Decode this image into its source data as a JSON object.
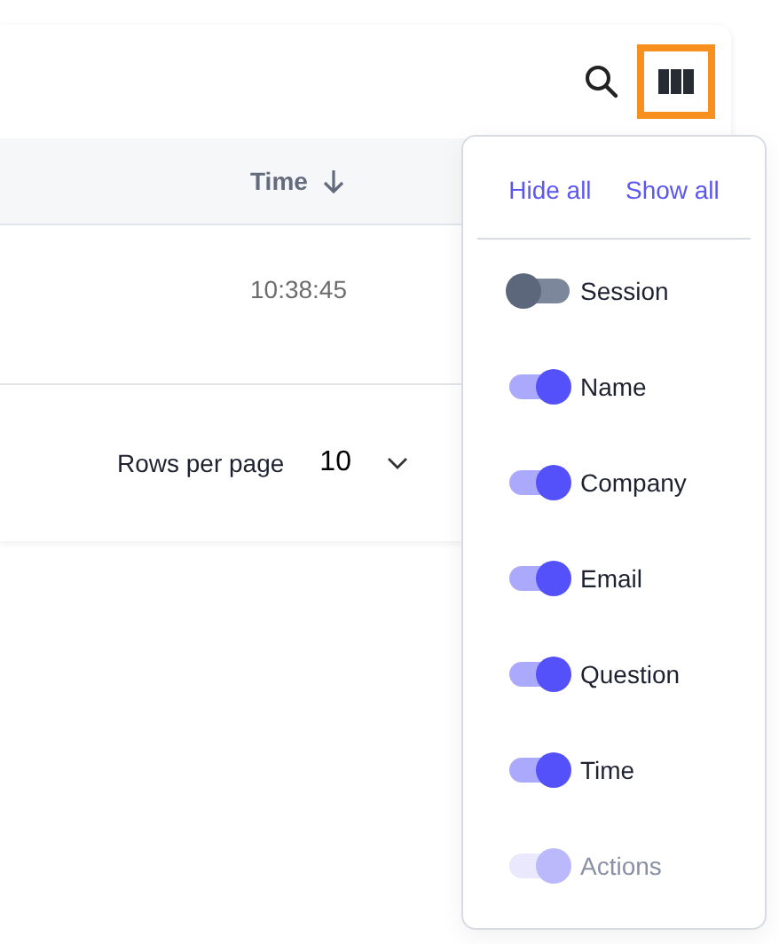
{
  "table": {
    "columns": [
      {
        "label": "Time",
        "sorted_descending": true
      }
    ],
    "rows": [
      {
        "time": "10:38:45"
      }
    ],
    "footer": {
      "rows_per_page_label": "Rows per page",
      "rows_per_page": "10"
    }
  },
  "column_menu": {
    "hide_all": "Hide all",
    "show_all": "Show all",
    "columns": [
      {
        "label": "Session",
        "checked": false,
        "disabled": false
      },
      {
        "label": "Name",
        "checked": true,
        "disabled": false
      },
      {
        "label": "Company",
        "checked": true,
        "disabled": false
      },
      {
        "label": "Email",
        "checked": true,
        "disabled": false
      },
      {
        "label": "Question",
        "checked": true,
        "disabled": false
      },
      {
        "label": "Time",
        "checked": true,
        "disabled": false
      },
      {
        "label": "Actions",
        "checked": true,
        "disabled": true
      }
    ]
  }
}
